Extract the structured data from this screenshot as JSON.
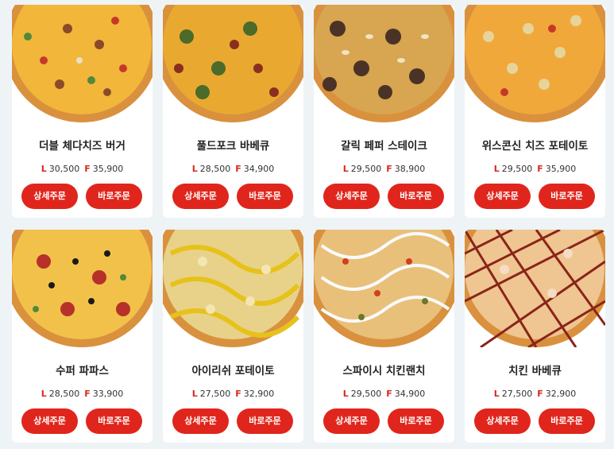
{
  "products": [
    {
      "name": "더블 체다치즈 버거",
      "large_label": "L",
      "large_price": "30,500",
      "family_label": "F",
      "family_price": "35,900",
      "detail_label": "상세주문",
      "order_label": "바로주문",
      "image": "double-cheddar-burger-pizza"
    },
    {
      "name": "풀드포크 바베큐",
      "large_label": "L",
      "large_price": "28,500",
      "family_label": "F",
      "family_price": "34,900",
      "detail_label": "상세주문",
      "order_label": "바로주문",
      "image": "pulled-pork-bbq-pizza"
    },
    {
      "name": "갈릭 페퍼 스테이크",
      "large_label": "L",
      "large_price": "29,500",
      "family_label": "F",
      "family_price": "38,900",
      "detail_label": "상세주문",
      "order_label": "바로주문",
      "image": "garlic-pepper-steak-pizza"
    },
    {
      "name": "위스콘신 치즈 포테이토",
      "large_label": "L",
      "large_price": "29,500",
      "family_label": "F",
      "family_price": "35,900",
      "detail_label": "상세주문",
      "order_label": "바로주문",
      "image": "wisconsin-cheese-potato-pizza"
    },
    {
      "name": "수퍼 파파스",
      "large_label": "L",
      "large_price": "28,500",
      "family_label": "F",
      "family_price": "33,900",
      "detail_label": "상세주문",
      "order_label": "바로주문",
      "image": "super-papas-pizza"
    },
    {
      "name": "아이리쉬 포테이토",
      "large_label": "L",
      "large_price": "27,500",
      "family_label": "F",
      "family_price": "32,900",
      "detail_label": "상세주문",
      "order_label": "바로주문",
      "image": "irish-potato-pizza"
    },
    {
      "name": "스파이시 치킨랜치",
      "large_label": "L",
      "large_price": "29,500",
      "family_label": "F",
      "family_price": "34,900",
      "detail_label": "상세주문",
      "order_label": "바로주문",
      "image": "spicy-chicken-ranch-pizza"
    },
    {
      "name": "치킨 바베큐",
      "large_label": "L",
      "large_price": "27,500",
      "family_label": "F",
      "family_price": "32,900",
      "detail_label": "상세주문",
      "order_label": "바로주문",
      "image": "chicken-bbq-pizza"
    }
  ],
  "colors": {
    "accent": "#e0261c",
    "price_tag": "#d42a1e",
    "background": "#eef3f6",
    "card": "#ffffff"
  }
}
